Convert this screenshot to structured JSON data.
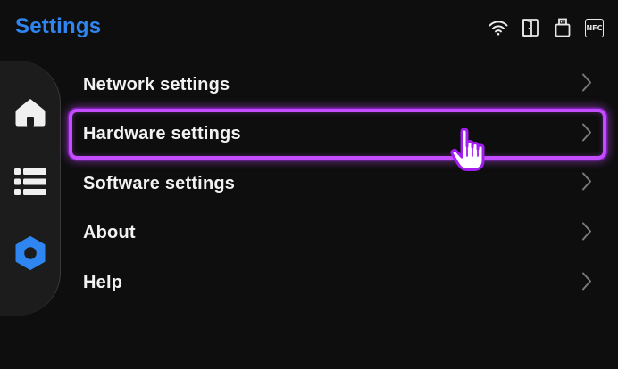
{
  "header": {
    "title": "Settings",
    "status_icons": [
      "wifi-icon",
      "door-icon",
      "usb-icon",
      "nfc-icon"
    ],
    "nfc_label": "NFC"
  },
  "nav": {
    "items": [
      {
        "icon": "home-icon",
        "active": false
      },
      {
        "icon": "list-icon",
        "active": false
      },
      {
        "icon": "settings-gear-icon",
        "active": true
      }
    ]
  },
  "menu": {
    "items": [
      {
        "label": "Network settings"
      },
      {
        "label": "Hardware settings",
        "highlighted": true
      },
      {
        "label": "Software settings"
      },
      {
        "label": "About"
      },
      {
        "label": "Help"
      }
    ]
  },
  "colors": {
    "accent": "#2f86f0",
    "highlight": "#c44dff",
    "background": "#0e0e0e"
  }
}
